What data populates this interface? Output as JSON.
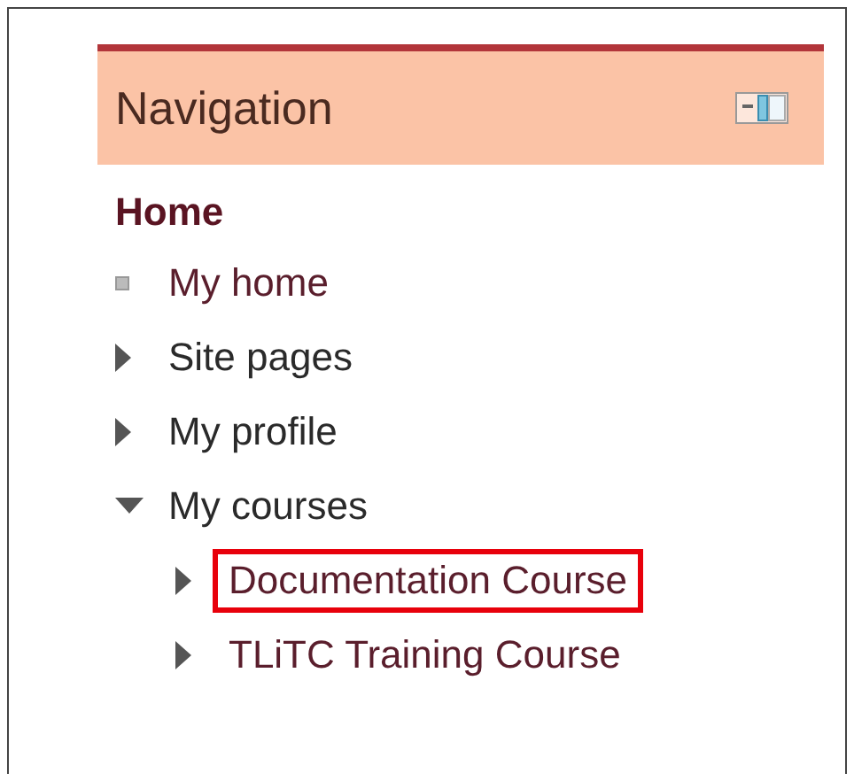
{
  "block": {
    "title": "Navigation",
    "home": "Home",
    "items": [
      {
        "label": "My home",
        "kind": "leaf",
        "link": true,
        "highlighted": false
      },
      {
        "label": "Site pages",
        "kind": "branch",
        "expanded": false,
        "link": false,
        "highlighted": false
      },
      {
        "label": "My profile",
        "kind": "branch",
        "expanded": false,
        "link": false,
        "highlighted": false
      },
      {
        "label": "My courses",
        "kind": "branch",
        "expanded": true,
        "link": false,
        "highlighted": false,
        "children": [
          {
            "label": "Documentation Course",
            "kind": "branch",
            "expanded": false,
            "link": true,
            "highlighted": true
          },
          {
            "label": "TLiTC Training Course",
            "kind": "branch",
            "expanded": false,
            "link": true,
            "highlighted": false
          }
        ]
      }
    ]
  }
}
